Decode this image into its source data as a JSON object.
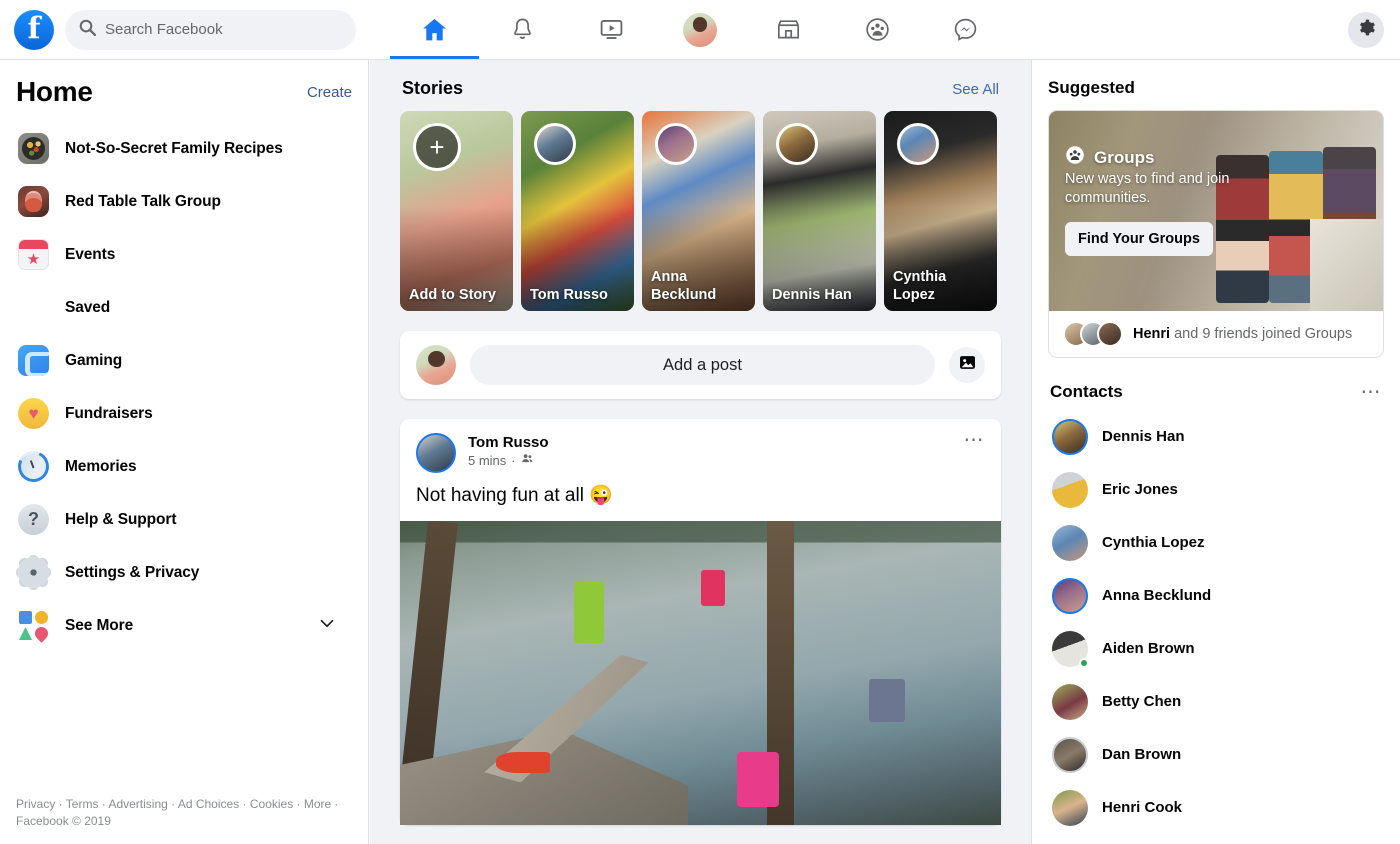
{
  "topbar": {
    "logo_icon": "facebook-logo",
    "search": {
      "placeholder": "Search Facebook",
      "icon": "search-icon"
    },
    "nav": [
      {
        "name": "home",
        "icon": "home-icon",
        "active": true
      },
      {
        "name": "notifications",
        "icon": "bell-icon",
        "active": false
      },
      {
        "name": "watch",
        "icon": "video-icon",
        "active": false
      },
      {
        "name": "profile",
        "icon": "avatar",
        "active": false
      },
      {
        "name": "marketplace",
        "icon": "shop-icon",
        "active": false
      },
      {
        "name": "groups",
        "icon": "groups-icon",
        "active": false
      },
      {
        "name": "messenger",
        "icon": "messenger-icon",
        "active": false
      }
    ],
    "settings_icon": "gear-icon",
    "accent_color": "#1877f2"
  },
  "sidebar": {
    "title": "Home",
    "create_label": "Create",
    "items": [
      {
        "label": "Not-So-Secret Family Recipes",
        "icon": "group-photo-icon"
      },
      {
        "label": "Red Table Talk Group",
        "icon": "group-photo-icon"
      },
      {
        "label": "Events",
        "icon": "events-icon"
      },
      {
        "label": "Saved",
        "icon": "bookmark-icon"
      },
      {
        "label": "Gaming",
        "icon": "gaming-icon"
      },
      {
        "label": "Fundraisers",
        "icon": "fundraisers-icon"
      },
      {
        "label": "Memories",
        "icon": "memories-icon"
      },
      {
        "label": "Help & Support",
        "icon": "help-icon"
      },
      {
        "label": "Settings & Privacy",
        "icon": "settings-icon"
      },
      {
        "label": "See More",
        "icon": "see-more-icon"
      }
    ],
    "footer": "Privacy · Terms · Advertising · Ad Choices · Cookies · More · Facebook © 2019"
  },
  "feed": {
    "stories": {
      "title": "Stories",
      "see_all": "See All",
      "items": [
        {
          "label": "Add to Story",
          "type": "add",
          "photo": "ph-add",
          "avatar": ""
        },
        {
          "label": "Tom Russo",
          "type": "story",
          "photo": "ph-tom",
          "avatar": "ava-tom"
        },
        {
          "label": "Anna Becklund",
          "type": "story",
          "photo": "ph-anna",
          "avatar": "ava-anna"
        },
        {
          "label": "Dennis Han",
          "type": "story",
          "photo": "ph-den",
          "avatar": "ava-den"
        },
        {
          "label": "Cynthia Lopez",
          "type": "story",
          "photo": "ph-cyn",
          "avatar": "ava-cyn"
        }
      ]
    },
    "composer": {
      "placeholder": "Add a post",
      "photo_icon": "photo-icon",
      "avatar": "user-avatar"
    },
    "post": {
      "author": "Tom Russo",
      "timestamp": "5 mins",
      "separator": "·",
      "audience_icon": "friends-icon",
      "menu_icon": "ellipsis-icon",
      "text": "Not having fun at all 😜",
      "image_alt": "people jumping off a dock into a lake"
    }
  },
  "rightbar": {
    "suggested_title": "Suggested",
    "suggested_card": {
      "brand": "Groups",
      "brand_icon": "groups-icon",
      "description": "New ways to find and join communities.",
      "button_label": "Find Your Groups",
      "footer_prefix": "Henri",
      "footer_rest": " and 9 friends joined Groups"
    },
    "contacts_title": "Contacts",
    "contacts_menu_icon": "ellipsis-icon",
    "contacts": [
      {
        "name": "Dennis Han",
        "ring": "blue",
        "online": false,
        "ava": "av1"
      },
      {
        "name": "Eric Jones",
        "ring": "none",
        "online": false,
        "ava": "av2"
      },
      {
        "name": "Cynthia Lopez",
        "ring": "none",
        "online": false,
        "ava": "av3"
      },
      {
        "name": "Anna Becklund",
        "ring": "blue",
        "online": false,
        "ava": "av4"
      },
      {
        "name": "Aiden Brown",
        "ring": "none",
        "online": true,
        "ava": "av5"
      },
      {
        "name": "Betty Chen",
        "ring": "none",
        "online": false,
        "ava": "av6"
      },
      {
        "name": "Dan Brown",
        "ring": "gray",
        "online": false,
        "ava": "av7"
      },
      {
        "name": "Henri Cook",
        "ring": "none",
        "online": false,
        "ava": "av8"
      }
    ]
  },
  "colors": {
    "brand_blue": "#1877f2",
    "link_blue": "#385898",
    "page_bg": "#f0f2f5",
    "online_green": "#31a24c"
  }
}
